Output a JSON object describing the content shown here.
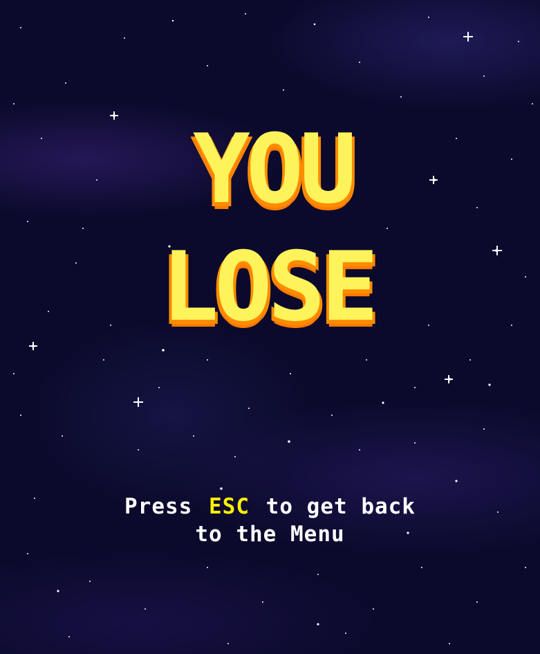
{
  "screen": {
    "title_lines": [
      "YOU",
      "LOSE"
    ],
    "hint": {
      "prefix": "Press",
      "key": "ESC",
      "suffix": "to get back",
      "line2": "to the Menu"
    }
  },
  "colors": {
    "background": "#0b0a2c",
    "title_fill": "#fff35c",
    "title_shadow": "#ff8c00",
    "hint_text": "#ffffff",
    "key_text": "#fff200"
  }
}
